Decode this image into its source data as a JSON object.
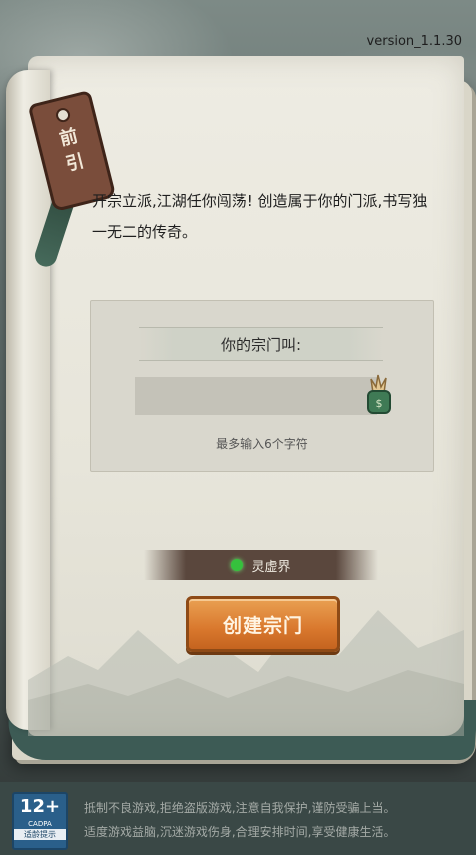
{
  "version": "version_1.1.30",
  "tag": {
    "char1": "前",
    "char2": "引"
  },
  "intro": "开宗立派,江湖任你闯荡! 创造属于你的门派,书写独一无二的传奇。",
  "form": {
    "banner": "你的宗门叫:",
    "name_value": "",
    "hint": "最多输入6个字符"
  },
  "server": {
    "name": "灵虚界",
    "status_color": "#36c13d"
  },
  "create_button": "创建宗门",
  "footer": {
    "age_rating": "12+",
    "age_org": "CADPA",
    "age_label": "适龄提示",
    "notice_line1": "抵制不良游戏,拒绝盗版游戏,注意自我保护,谨防受骗上当。",
    "notice_line2": "适度游戏益脑,沉迷游戏伤身,合理安排时间,享受健康生活。"
  }
}
